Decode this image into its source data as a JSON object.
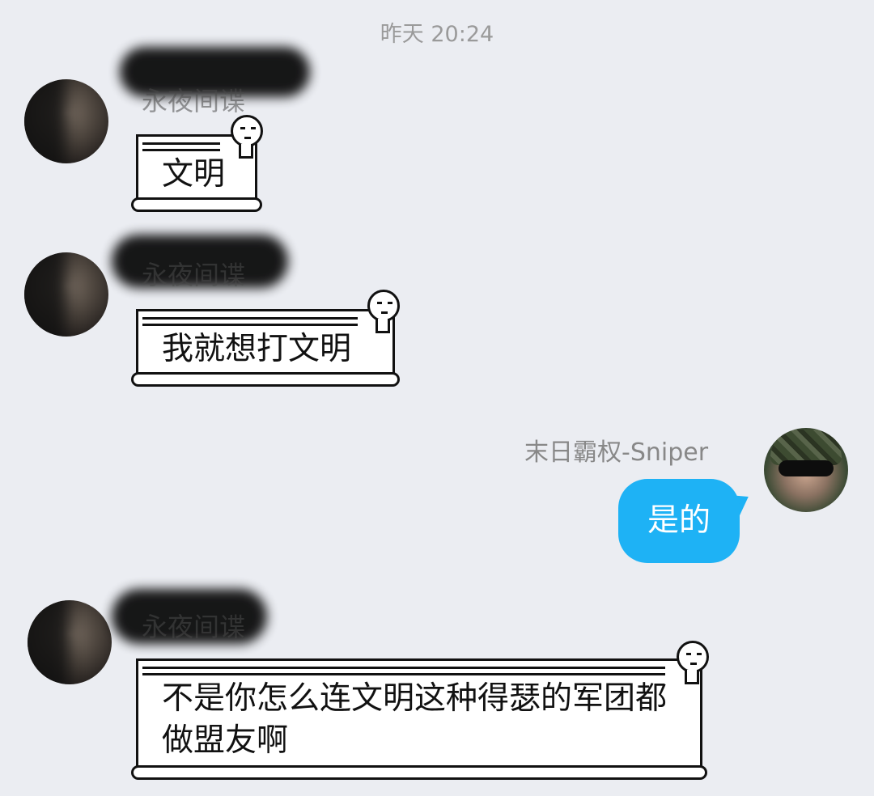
{
  "timestamp": "昨天 20:24",
  "messages": [
    {
      "sender": "永夜间谍",
      "text": "文明"
    },
    {
      "sender": "永夜间谍",
      "text": "我就想打文明"
    },
    {
      "sender": "末日霸权-Sniper",
      "text": "是的"
    },
    {
      "sender": "永夜间谍",
      "text": "不是你怎么连文明这种得瑟的军团都做盟友啊"
    }
  ],
  "colors": {
    "background": "#ebedf2",
    "outgoing_bubble": "#1eb2f5"
  }
}
